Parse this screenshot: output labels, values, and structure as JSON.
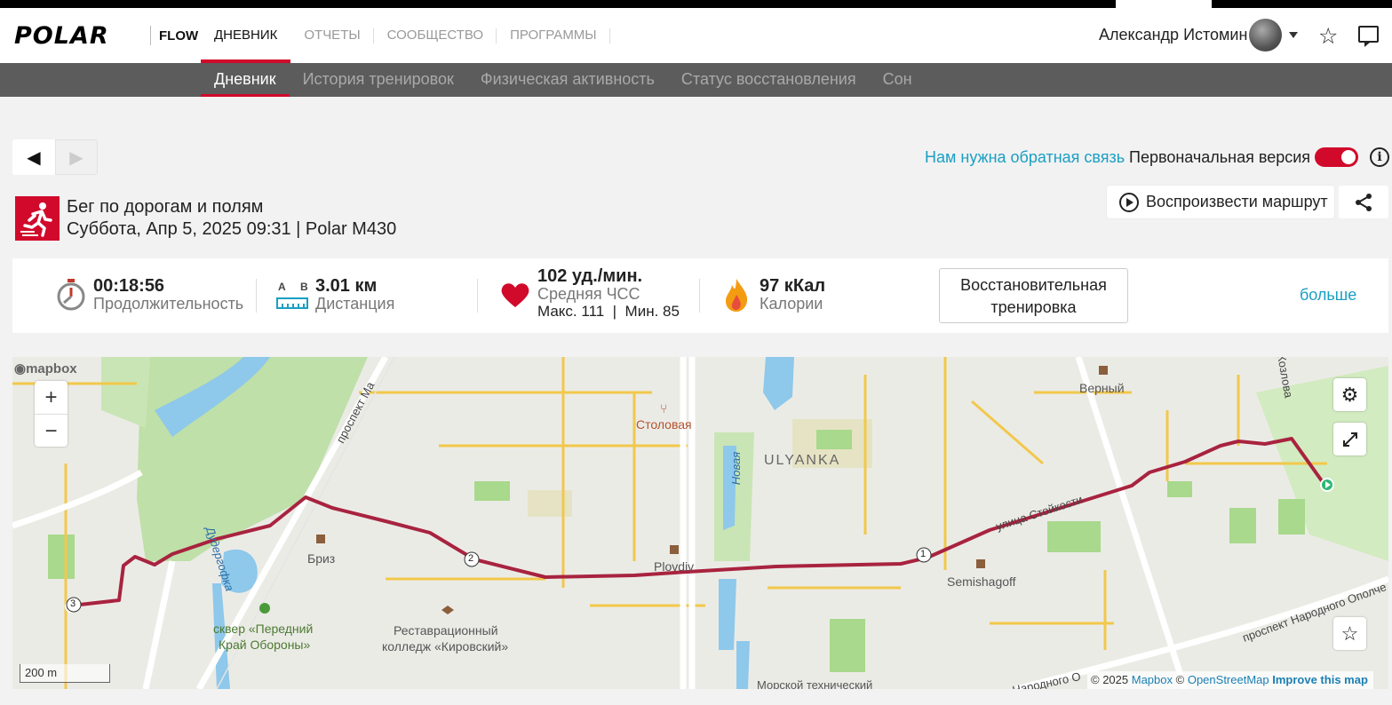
{
  "brand": {
    "logo": "POLAR",
    "product": "FLOW"
  },
  "main_nav": [
    "ДНЕВНИК",
    "ОТЧЕТЫ",
    "СООБЩЕСТВО",
    "ПРОГРАММЫ"
  ],
  "user": {
    "name": "Александр Истомин"
  },
  "sub_nav": [
    "Дневник",
    "История тренировок",
    "Физическая активность",
    "Статус восстановления",
    "Сон"
  ],
  "pager": {
    "prev": "◀",
    "next": "▶"
  },
  "feedback_link": "Нам нужна обратная связь",
  "original_version": {
    "label": "Первоначальная версия",
    "enabled": true
  },
  "info_icon": "i",
  "activity": {
    "title": "Бег по дорогам и полям",
    "subtitle": "Суббота, Апр 5, 2025 09:31 | Polar M430",
    "sport_icon": "running-icon"
  },
  "replay_button": "Воспроизвести маршрут",
  "stats": {
    "duration": {
      "value": "00:18:56",
      "label": "Продолжительность"
    },
    "distance": {
      "value": "3.01 км",
      "label": "Дистанция",
      "a": "A",
      "b": "B"
    },
    "heart": {
      "value": "102 уд./мин.",
      "label": "Средняя ЧСС",
      "minmax": "Макс. 111  |  Мин. 85"
    },
    "calories": {
      "value": "97 кКал",
      "label": "Калории"
    }
  },
  "recovery_button": {
    "line1": "Восстановительная",
    "line2": "тренировка"
  },
  "more_link": "больше",
  "map": {
    "labels": {
      "stolovaya": "Столовая",
      "ulyanka": "ULYANKA",
      "verny": "Верный",
      "briz": "Бриз",
      "plovdiv": "Plovdiv",
      "semishagoff": "Semishagoff",
      "skver1": "сквер «Передний",
      "skver2": "Край Обороны»",
      "college1": "Реставрационный",
      "college2": "колледж «Кировский»",
      "prospekt_ma": "проспект Ма",
      "stoikosti": "улица Стойкости",
      "novaya": "Новая",
      "dudergofka": "Дудергофка",
      "kozlova": "Козлова",
      "narodnogo": "проспект Народного Ополче",
      "narodnogo2": "Народного О",
      "morskoy": "Морской технический"
    },
    "markers": [
      "1",
      "2",
      "3"
    ],
    "zoom_in": "+",
    "zoom_out": "−",
    "logo": "mapbox",
    "scale": "200 m",
    "attribution": {
      "copy": "© 2025",
      "mapbox": "Mapbox",
      "osm_pre": "©",
      "osm": "OpenStreetMap",
      "improve": "Improve this map"
    },
    "route_color": "#a8233f"
  },
  "colors": {
    "accent": "#d10a2b",
    "link": "#1a9fc3"
  }
}
